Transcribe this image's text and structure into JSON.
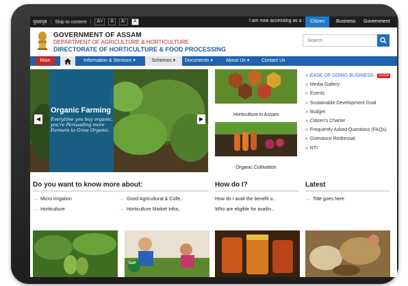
{
  "topbar": {
    "site_label": "मुख्यपृष्ठ",
    "skip": "Skip to content",
    "font_buttons": [
      "A+",
      "A",
      "A-",
      "A"
    ],
    "access_label": "I am now accessing as a :",
    "audiences": [
      "Citizen",
      "Business",
      "Government"
    ],
    "selected_audience": "Citizen"
  },
  "header": {
    "gov": "GOVERNMENT OF ASSAM",
    "dept": "DEPARTMENT OF AGRICULTURE & HORTICULTURE",
    "directorate": "DIRECTORATE OF HORTICULTURE & FOOD PROCESSING",
    "search_placeholder": "Search"
  },
  "nav": {
    "main": "Main",
    "info": "Information & Services",
    "schemes": "Schemes",
    "documents": "Documents",
    "about": "About Us",
    "contact": "Contact Us"
  },
  "slider": {
    "title": "Organic Farming",
    "subtitle": "Everytime you buy organic, you're Persuading more Farmers to Grow Organic."
  },
  "thumbs": [
    {
      "caption": "Horticulture in Assam"
    },
    {
      "caption": "Organic Cultivation"
    }
  ],
  "links": [
    "EASE OF DOING BUSINESS",
    "Media Gallery",
    "Events",
    "Sustainable Development Goal",
    "Budget",
    "Citizen's Charter",
    "Frequently Asked Questions (FAQs)",
    "Grievance Redressal",
    "RTI"
  ],
  "click_badge": "CLICK",
  "sections": {
    "know_more": {
      "title": "Do you want to know more about:",
      "items": [
        "Micro irrigation",
        "Horticulture",
        "Good Agricultural & Colle..",
        "Horticulture Market Infra.."
      ]
    },
    "how_do_i": {
      "title": "How do I?",
      "items": [
        "How do I avail the benefit o..",
        "Who are eligible for availin.."
      ]
    },
    "latest": {
      "title": "Latest",
      "items": [
        "Title goes here"
      ]
    }
  },
  "bottom_badge": "GAP",
  "colors": {
    "accent_blue": "#1f62b0",
    "accent_red": "#c2282b",
    "link_blue": "#1f6fc0"
  }
}
